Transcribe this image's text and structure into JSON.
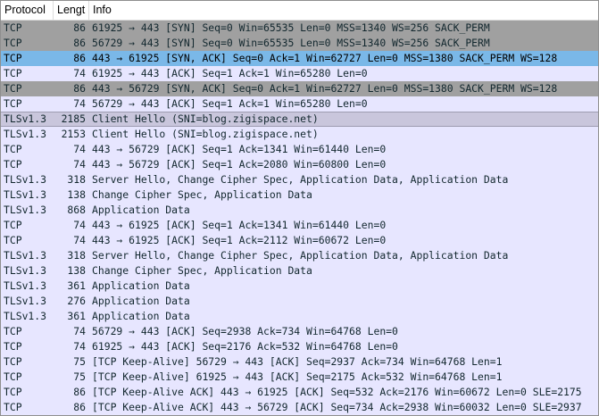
{
  "header": {
    "protocol": "Protocol",
    "length": "Lengt",
    "info": "Info"
  },
  "colors": {
    "bad_tcp_row": "#a0a0a0",
    "tcp_row": "#e7e6ff",
    "selected_row": "#7ab8e8",
    "highlight_row": "#c9c6dc"
  },
  "packets": [
    {
      "protocol": "TCP",
      "length": "86",
      "info": "61925 → 443 [SYN] Seq=0 Win=65535 Len=0 MSS=1340 WS=256 SACK_PERM",
      "style": "tcp-bad"
    },
    {
      "protocol": "TCP",
      "length": "86",
      "info": "56729 → 443 [SYN] Seq=0 Win=65535 Len=0 MSS=1340 WS=256 SACK_PERM",
      "style": "tcp-bad"
    },
    {
      "protocol": "TCP",
      "length": "86",
      "info": "443 → 61925 [SYN, ACK] Seq=0 Ack=1 Win=62727 Len=0 MSS=1380 SACK_PERM WS=128",
      "style": "selected"
    },
    {
      "protocol": "TCP",
      "length": "74",
      "info": "61925 → 443 [ACK] Seq=1 Ack=1 Win=65280 Len=0",
      "style": "tcp"
    },
    {
      "protocol": "TCP",
      "length": "86",
      "info": "443 → 56729 [SYN, ACK] Seq=0 Ack=1 Win=62727 Len=0 MSS=1380 SACK_PERM WS=128",
      "style": "tcp-bad"
    },
    {
      "protocol": "TCP",
      "length": "74",
      "info": "56729 → 443 [ACK] Seq=1 Ack=1 Win=65280 Len=0",
      "style": "tcp"
    },
    {
      "protocol": "TLSv1.3",
      "length": "2185",
      "info": "Client Hello (SNI=blog.zigispace.net)",
      "style": "hover"
    },
    {
      "protocol": "TLSv1.3",
      "length": "2153",
      "info": "Client Hello (SNI=blog.zigispace.net)",
      "style": "tls"
    },
    {
      "protocol": "TCP",
      "length": "74",
      "info": "443 → 56729 [ACK] Seq=1 Ack=1341 Win=61440 Len=0",
      "style": "tcp"
    },
    {
      "protocol": "TCP",
      "length": "74",
      "info": "443 → 56729 [ACK] Seq=1 Ack=2080 Win=60800 Len=0",
      "style": "tcp"
    },
    {
      "protocol": "TLSv1.3",
      "length": "318",
      "info": "Server Hello, Change Cipher Spec, Application Data, Application Data",
      "style": "tls"
    },
    {
      "protocol": "TLSv1.3",
      "length": "138",
      "info": "Change Cipher Spec, Application Data",
      "style": "tls"
    },
    {
      "protocol": "TLSv1.3",
      "length": "868",
      "info": "Application Data",
      "style": "tls"
    },
    {
      "protocol": "TCP",
      "length": "74",
      "info": "443 → 61925 [ACK] Seq=1 Ack=1341 Win=61440 Len=0",
      "style": "tcp"
    },
    {
      "protocol": "TCP",
      "length": "74",
      "info": "443 → 61925 [ACK] Seq=1 Ack=2112 Win=60672 Len=0",
      "style": "tcp"
    },
    {
      "protocol": "TLSv1.3",
      "length": "318",
      "info": "Server Hello, Change Cipher Spec, Application Data, Application Data",
      "style": "tls"
    },
    {
      "protocol": "TLSv1.3",
      "length": "138",
      "info": "Change Cipher Spec, Application Data",
      "style": "tls"
    },
    {
      "protocol": "TLSv1.3",
      "length": "361",
      "info": "Application Data",
      "style": "tls"
    },
    {
      "protocol": "TLSv1.3",
      "length": "276",
      "info": "Application Data",
      "style": "tls"
    },
    {
      "protocol": "TLSv1.3",
      "length": "361",
      "info": "Application Data",
      "style": "tls"
    },
    {
      "protocol": "TCP",
      "length": "74",
      "info": "56729 → 443 [ACK] Seq=2938 Ack=734 Win=64768 Len=0",
      "style": "tcp"
    },
    {
      "protocol": "TCP",
      "length": "74",
      "info": "61925 → 443 [ACK] Seq=2176 Ack=532 Win=64768 Len=0",
      "style": "tcp"
    },
    {
      "protocol": "TCP",
      "length": "75",
      "info": "[TCP Keep-Alive] 56729 → 443 [ACK] Seq=2937 Ack=734 Win=64768 Len=1",
      "style": "tcp"
    },
    {
      "protocol": "TCP",
      "length": "75",
      "info": "[TCP Keep-Alive] 61925 → 443 [ACK] Seq=2175 Ack=532 Win=64768 Len=1",
      "style": "tcp"
    },
    {
      "protocol": "TCP",
      "length": "86",
      "info": "[TCP Keep-Alive ACK] 443 → 61925 [ACK] Seq=532 Ack=2176 Win=60672 Len=0 SLE=2175",
      "style": "tcp"
    },
    {
      "protocol": "TCP",
      "length": "86",
      "info": "[TCP Keep-Alive ACK] 443 → 56729 [ACK] Seq=734 Ack=2938 Win=60032 Len=0 SLE=2937",
      "style": "tcp"
    }
  ]
}
